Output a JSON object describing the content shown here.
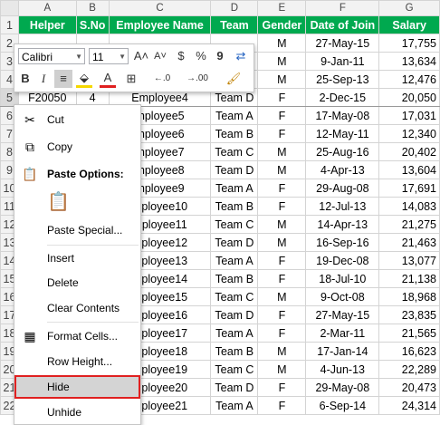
{
  "columns": [
    "A",
    "B",
    "C",
    "D",
    "E",
    "F",
    "G"
  ],
  "headers": [
    "Helper",
    "S.No",
    "Employee Name",
    "Team",
    "Gender",
    "Date of Join",
    "Salary"
  ],
  "rows": [
    {
      "n": "2",
      "cells": [
        "",
        "",
        "",
        "",
        "M",
        "27-May-15",
        "17,755"
      ]
    },
    {
      "n": "3",
      "cells": [
        "",
        "",
        "",
        "",
        "M",
        "9-Jan-11",
        "13,634"
      ]
    },
    {
      "n": "4",
      "cells": [
        "",
        "",
        "",
        "",
        "M",
        "25-Sep-13",
        "12,476"
      ]
    },
    {
      "n": "5",
      "cells": [
        "F20050",
        "4",
        "Employee4",
        "Team D",
        "F",
        "2-Dec-15",
        "20,050"
      ]
    },
    {
      "n": "6",
      "cells": [
        "",
        "",
        "mployee5",
        "Team A",
        "F",
        "17-May-08",
        "17,031"
      ]
    },
    {
      "n": "7",
      "cells": [
        "",
        "",
        "mployee6",
        "Team B",
        "F",
        "12-May-11",
        "12,340"
      ]
    },
    {
      "n": "8",
      "cells": [
        "",
        "",
        "mployee7",
        "Team C",
        "M",
        "25-Aug-16",
        "20,402"
      ]
    },
    {
      "n": "9",
      "cells": [
        "",
        "",
        "mployee8",
        "Team D",
        "M",
        "4-Apr-13",
        "13,604"
      ]
    },
    {
      "n": "10",
      "cells": [
        "",
        "",
        "mployee9",
        "Team A",
        "F",
        "29-Aug-08",
        "17,691"
      ]
    },
    {
      "n": "11",
      "cells": [
        "",
        "",
        "mployee10",
        "Team B",
        "F",
        "12-Jul-13",
        "14,083"
      ]
    },
    {
      "n": "12",
      "cells": [
        "",
        "",
        "mployee11",
        "Team C",
        "M",
        "14-Apr-13",
        "21,275"
      ]
    },
    {
      "n": "13",
      "cells": [
        "",
        "",
        "mployee12",
        "Team D",
        "M",
        "16-Sep-16",
        "21,463"
      ]
    },
    {
      "n": "14",
      "cells": [
        "",
        "",
        "mployee13",
        "Team A",
        "F",
        "19-Dec-08",
        "13,077"
      ]
    },
    {
      "n": "15",
      "cells": [
        "",
        "",
        "mployee14",
        "Team B",
        "F",
        "18-Jul-10",
        "21,138"
      ]
    },
    {
      "n": "16",
      "cells": [
        "",
        "",
        "mployee15",
        "Team C",
        "M",
        "9-Oct-08",
        "18,968"
      ]
    },
    {
      "n": "17",
      "cells": [
        "",
        "",
        "mployee16",
        "Team D",
        "F",
        "27-May-15",
        "23,835"
      ]
    },
    {
      "n": "18",
      "cells": [
        "",
        "",
        "mployee17",
        "Team A",
        "F",
        "2-Mar-11",
        "21,565"
      ]
    },
    {
      "n": "19",
      "cells": [
        "",
        "",
        "mployee18",
        "Team B",
        "M",
        "17-Jan-14",
        "16,623"
      ]
    },
    {
      "n": "20",
      "cells": [
        "",
        "",
        "mployee19",
        "Team C",
        "M",
        "4-Jun-13",
        "22,289"
      ]
    },
    {
      "n": "21",
      "cells": [
        "",
        "",
        "mployee20",
        "Team D",
        "F",
        "29-May-08",
        "20,473"
      ]
    },
    {
      "n": "22",
      "cells": [
        "",
        "",
        "mployee21",
        "Team A",
        "F",
        "6-Sep-14",
        "24,314"
      ]
    }
  ],
  "mini_toolbar": {
    "font": "Calibri",
    "size": "11",
    "row1": [
      "A˄",
      "A˅",
      "$",
      "%",
      "9",
      "⇄"
    ],
    "row2": [
      "B",
      "I",
      "≡",
      "A",
      "⊞",
      "←.0",
      "→.00",
      "✓"
    ]
  },
  "menu": {
    "cut": "Cut",
    "copy": "Copy",
    "paste_options": "Paste Options:",
    "paste_special": "Paste Special...",
    "insert": "Insert",
    "delete": "Delete",
    "clear_contents": "Clear Contents",
    "format_cells": "Format Cells...",
    "row_height": "Row Height...",
    "hide": "Hide",
    "unhide": "Unhide"
  },
  "colors": {
    "header_green": "#00a94f",
    "highlight_border": "#e02020"
  }
}
